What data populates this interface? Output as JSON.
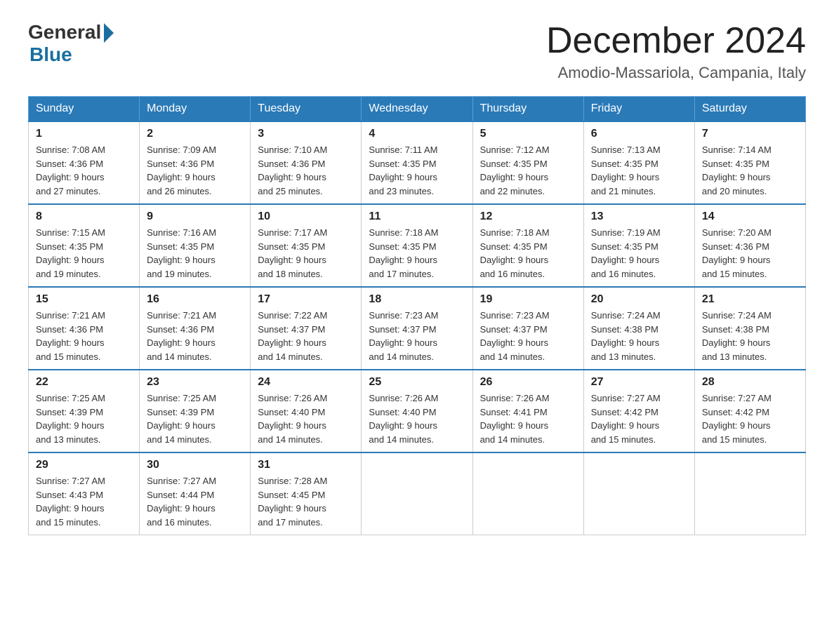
{
  "logo": {
    "general": "General",
    "blue": "Blue"
  },
  "title": "December 2024",
  "subtitle": "Amodio-Massariola, Campania, Italy",
  "days_of_week": [
    "Sunday",
    "Monday",
    "Tuesday",
    "Wednesday",
    "Thursday",
    "Friday",
    "Saturday"
  ],
  "weeks": [
    [
      {
        "day": "1",
        "sunrise": "7:08 AM",
        "sunset": "4:36 PM",
        "daylight": "9 hours and 27 minutes."
      },
      {
        "day": "2",
        "sunrise": "7:09 AM",
        "sunset": "4:36 PM",
        "daylight": "9 hours and 26 minutes."
      },
      {
        "day": "3",
        "sunrise": "7:10 AM",
        "sunset": "4:36 PM",
        "daylight": "9 hours and 25 minutes."
      },
      {
        "day": "4",
        "sunrise": "7:11 AM",
        "sunset": "4:35 PM",
        "daylight": "9 hours and 23 minutes."
      },
      {
        "day": "5",
        "sunrise": "7:12 AM",
        "sunset": "4:35 PM",
        "daylight": "9 hours and 22 minutes."
      },
      {
        "day": "6",
        "sunrise": "7:13 AM",
        "sunset": "4:35 PM",
        "daylight": "9 hours and 21 minutes."
      },
      {
        "day": "7",
        "sunrise": "7:14 AM",
        "sunset": "4:35 PM",
        "daylight": "9 hours and 20 minutes."
      }
    ],
    [
      {
        "day": "8",
        "sunrise": "7:15 AM",
        "sunset": "4:35 PM",
        "daylight": "9 hours and 19 minutes."
      },
      {
        "day": "9",
        "sunrise": "7:16 AM",
        "sunset": "4:35 PM",
        "daylight": "9 hours and 19 minutes."
      },
      {
        "day": "10",
        "sunrise": "7:17 AM",
        "sunset": "4:35 PM",
        "daylight": "9 hours and 18 minutes."
      },
      {
        "day": "11",
        "sunrise": "7:18 AM",
        "sunset": "4:35 PM",
        "daylight": "9 hours and 17 minutes."
      },
      {
        "day": "12",
        "sunrise": "7:18 AM",
        "sunset": "4:35 PM",
        "daylight": "9 hours and 16 minutes."
      },
      {
        "day": "13",
        "sunrise": "7:19 AM",
        "sunset": "4:35 PM",
        "daylight": "9 hours and 16 minutes."
      },
      {
        "day": "14",
        "sunrise": "7:20 AM",
        "sunset": "4:36 PM",
        "daylight": "9 hours and 15 minutes."
      }
    ],
    [
      {
        "day": "15",
        "sunrise": "7:21 AM",
        "sunset": "4:36 PM",
        "daylight": "9 hours and 15 minutes."
      },
      {
        "day": "16",
        "sunrise": "7:21 AM",
        "sunset": "4:36 PM",
        "daylight": "9 hours and 14 minutes."
      },
      {
        "day": "17",
        "sunrise": "7:22 AM",
        "sunset": "4:37 PM",
        "daylight": "9 hours and 14 minutes."
      },
      {
        "day": "18",
        "sunrise": "7:23 AM",
        "sunset": "4:37 PM",
        "daylight": "9 hours and 14 minutes."
      },
      {
        "day": "19",
        "sunrise": "7:23 AM",
        "sunset": "4:37 PM",
        "daylight": "9 hours and 14 minutes."
      },
      {
        "day": "20",
        "sunrise": "7:24 AM",
        "sunset": "4:38 PM",
        "daylight": "9 hours and 13 minutes."
      },
      {
        "day": "21",
        "sunrise": "7:24 AM",
        "sunset": "4:38 PM",
        "daylight": "9 hours and 13 minutes."
      }
    ],
    [
      {
        "day": "22",
        "sunrise": "7:25 AM",
        "sunset": "4:39 PM",
        "daylight": "9 hours and 13 minutes."
      },
      {
        "day": "23",
        "sunrise": "7:25 AM",
        "sunset": "4:39 PM",
        "daylight": "9 hours and 14 minutes."
      },
      {
        "day": "24",
        "sunrise": "7:26 AM",
        "sunset": "4:40 PM",
        "daylight": "9 hours and 14 minutes."
      },
      {
        "day": "25",
        "sunrise": "7:26 AM",
        "sunset": "4:40 PM",
        "daylight": "9 hours and 14 minutes."
      },
      {
        "day": "26",
        "sunrise": "7:26 AM",
        "sunset": "4:41 PM",
        "daylight": "9 hours and 14 minutes."
      },
      {
        "day": "27",
        "sunrise": "7:27 AM",
        "sunset": "4:42 PM",
        "daylight": "9 hours and 15 minutes."
      },
      {
        "day": "28",
        "sunrise": "7:27 AM",
        "sunset": "4:42 PM",
        "daylight": "9 hours and 15 minutes."
      }
    ],
    [
      {
        "day": "29",
        "sunrise": "7:27 AM",
        "sunset": "4:43 PM",
        "daylight": "9 hours and 15 minutes."
      },
      {
        "day": "30",
        "sunrise": "7:27 AM",
        "sunset": "4:44 PM",
        "daylight": "9 hours and 16 minutes."
      },
      {
        "day": "31",
        "sunrise": "7:28 AM",
        "sunset": "4:45 PM",
        "daylight": "9 hours and 17 minutes."
      },
      null,
      null,
      null,
      null
    ]
  ],
  "labels": {
    "sunrise": "Sunrise:",
    "sunset": "Sunset:",
    "daylight": "Daylight:"
  }
}
